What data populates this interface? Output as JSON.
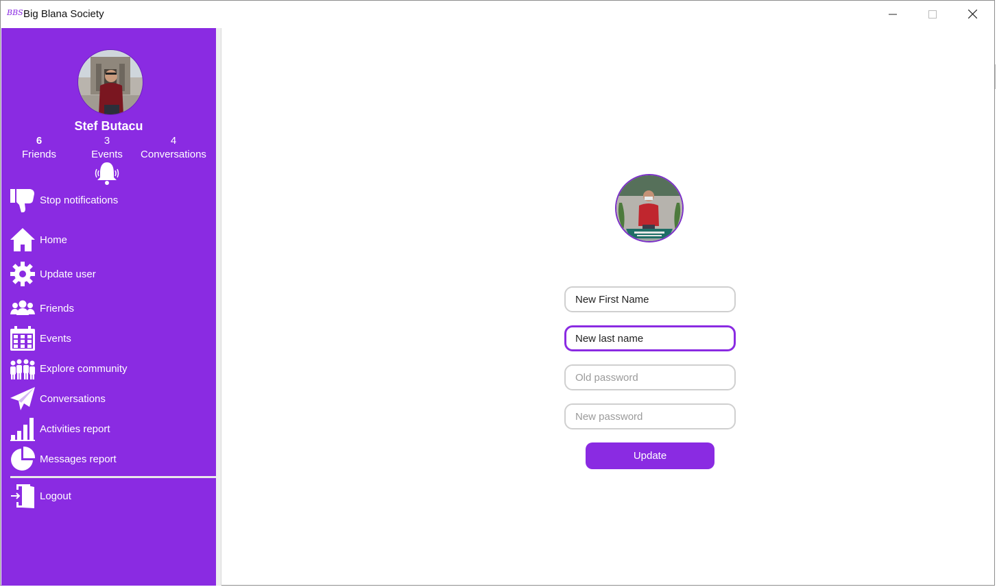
{
  "window": {
    "app_icon_text": "BBS",
    "title": "Big Blana Society",
    "controls": [
      "minimize-icon",
      "maximize-icon",
      "close-icon"
    ]
  },
  "sidebar": {
    "user_name": "Stef Butacu",
    "stats": [
      {
        "count": "6",
        "label": "Friends"
      },
      {
        "count": "3",
        "label": "Events"
      },
      {
        "count": "4",
        "label": "Conversations"
      }
    ],
    "notification_icon": "bell-ringing-icon",
    "items": [
      {
        "label": "Stop notifications",
        "icon": "thumbs-down-icon"
      },
      {
        "label": "Home",
        "icon": "home-icon"
      },
      {
        "label": "Update user",
        "icon": "gear-icon"
      },
      {
        "label": "Friends",
        "icon": "people-icon"
      },
      {
        "label": "Events",
        "icon": "calendar-icon"
      },
      {
        "label": "Explore community",
        "icon": "community-icon"
      },
      {
        "label": "Conversations",
        "icon": "paper-plane-icon"
      },
      {
        "label": "Activities report",
        "icon": "bar-chart-icon"
      },
      {
        "label": "Messages report",
        "icon": "pie-chart-icon"
      },
      {
        "label": "Logout",
        "icon": "logout-door-icon"
      }
    ]
  },
  "form": {
    "first_name": {
      "value": "New First Name",
      "placeholder": ""
    },
    "last_name": {
      "value": "New last name",
      "placeholder": ""
    },
    "old_password": {
      "value": "",
      "placeholder": "Old password"
    },
    "new_password": {
      "value": "",
      "placeholder": "New password"
    },
    "update_label": "Update"
  },
  "colors": {
    "accent": "#8a2be2",
    "sidebar_text": "#ffffff"
  }
}
